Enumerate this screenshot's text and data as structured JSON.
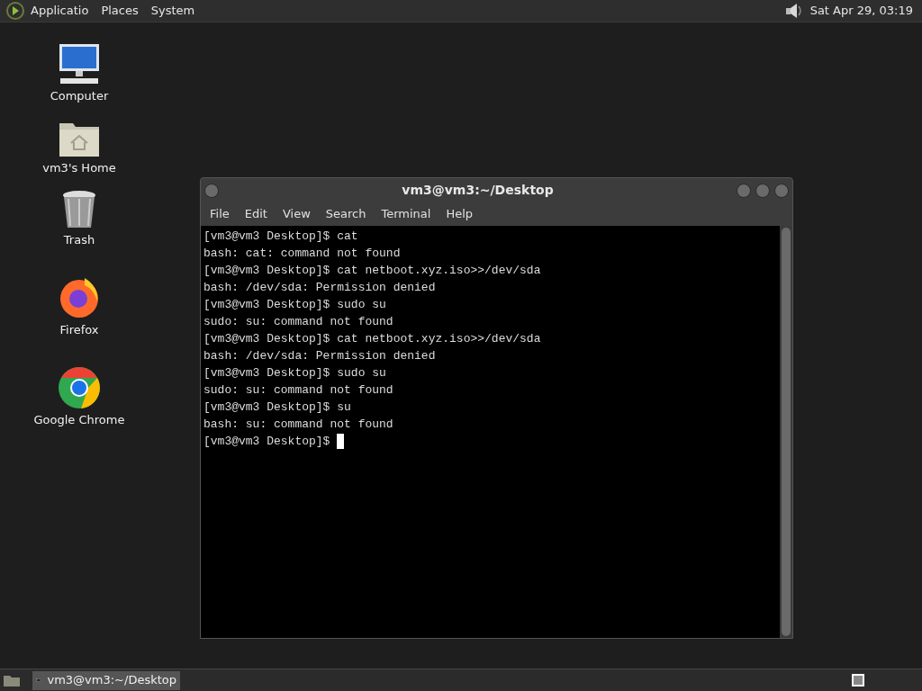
{
  "top_panel": {
    "menus": [
      "Applicatio",
      "Places",
      "System"
    ],
    "clock": "Sat Apr 29, 03:19"
  },
  "desktop_icons": [
    {
      "kind": "computer",
      "label": "Computer"
    },
    {
      "kind": "home",
      "label": "vm3's Home"
    },
    {
      "kind": "trash",
      "label": "Trash"
    },
    {
      "kind": "firefox",
      "label": "Firefox"
    },
    {
      "kind": "chrome",
      "label": "Google Chrome"
    }
  ],
  "terminal": {
    "title": "vm3@vm3:~/Desktop",
    "menu": [
      "File",
      "Edit",
      "View",
      "Search",
      "Terminal",
      "Help"
    ],
    "lines": [
      "[vm3@vm3 Desktop]$ cat",
      "bash: cat: command not found",
      "[vm3@vm3 Desktop]$ cat netboot.xyz.iso>>/dev/sda",
      "bash: /dev/sda: Permission denied",
      "[vm3@vm3 Desktop]$ sudo su",
      "sudo: su: command not found",
      "[vm3@vm3 Desktop]$ cat netboot.xyz.iso>>/dev/sda",
      "bash: /dev/sda: Permission denied",
      "[vm3@vm3 Desktop]$ sudo su",
      "sudo: su: command not found",
      "[vm3@vm3 Desktop]$ su",
      "bash: su: command not found",
      "[vm3@vm3 Desktop]$ "
    ]
  },
  "bottom_panel": {
    "tasks": [
      {
        "label": "vm3@vm3:~/Desktop",
        "selected": true
      }
    ]
  }
}
